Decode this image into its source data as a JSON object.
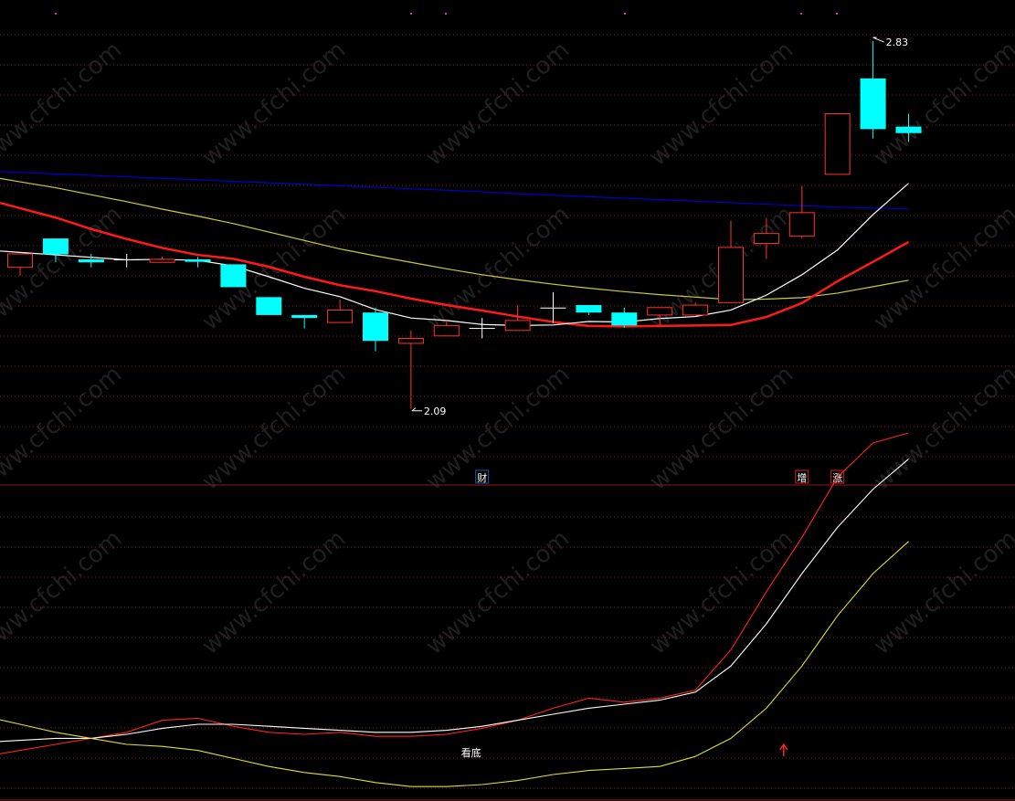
{
  "chart_data": [
    {
      "type": "candlestick",
      "title": "",
      "ylim": [
        1.972,
        2.876
      ],
      "candles": [
        {
          "open": 2.375,
          "close": 2.402,
          "high": 2.402,
          "low": 2.358
        },
        {
          "open": 2.433,
          "close": 2.401,
          "high": 2.433,
          "low": 2.385
        },
        {
          "open": 2.391,
          "close": 2.385,
          "high": 2.402,
          "low": 2.375
        },
        {
          "open": 2.391,
          "close": 2.391,
          "high": 2.402,
          "low": 2.375
        },
        {
          "open": 2.385,
          "close": 2.391,
          "high": 2.396,
          "low": 2.385
        },
        {
          "open": 2.391,
          "close": 2.386,
          "high": 2.396,
          "low": 2.375
        },
        {
          "open": 2.381,
          "close": 2.335,
          "high": 2.381,
          "low": 2.335
        },
        {
          "open": 2.315,
          "close": 2.279,
          "high": 2.315,
          "low": 2.279
        },
        {
          "open": 2.279,
          "close": 2.273,
          "high": 2.279,
          "low": 2.252
        },
        {
          "open": 2.264,
          "close": 2.289,
          "high": 2.31,
          "low": 2.264
        },
        {
          "open": 2.284,
          "close": 2.227,
          "high": 2.294,
          "low": 2.206
        },
        {
          "open": 2.222,
          "close": 2.232,
          "high": 2.248,
          "low": 2.09
        },
        {
          "open": 2.237,
          "close": 2.258,
          "high": 2.268,
          "low": 2.237
        },
        {
          "open": 2.253,
          "close": 2.253,
          "high": 2.273,
          "low": 2.232
        },
        {
          "open": 2.248,
          "close": 2.268,
          "high": 2.299,
          "low": 2.248
        },
        {
          "open": 2.294,
          "close": 2.294,
          "high": 2.325,
          "low": 2.263
        },
        {
          "open": 2.299,
          "close": 2.284,
          "high": 2.299,
          "low": 2.279
        },
        {
          "open": 2.284,
          "close": 2.258,
          "high": 2.294,
          "low": 2.253
        },
        {
          "open": 2.279,
          "close": 2.294,
          "high": 2.294,
          "low": 2.258
        },
        {
          "open": 2.279,
          "close": 2.299,
          "high": 2.304,
          "low": 2.279
        },
        {
          "open": 2.304,
          "close": 2.415,
          "high": 2.469,
          "low": 2.304
        },
        {
          "open": 2.423,
          "close": 2.443,
          "high": 2.474,
          "low": 2.392
        },
        {
          "open": 2.438,
          "close": 2.485,
          "high": 2.539,
          "low": 2.433
        },
        {
          "open": 2.562,
          "close": 2.684,
          "high": 2.684,
          "low": 2.562
        },
        {
          "open": 2.755,
          "close": 2.653,
          "high": 2.83,
          "low": 2.634
        },
        {
          "open": 2.658,
          "close": 2.645,
          "high": 2.684,
          "low": 2.627
        }
      ],
      "moving_averages": [
        {
          "color": "#0000cc",
          "values": [
            2.566,
            2.563,
            2.56,
            2.557,
            2.554,
            2.551,
            2.548,
            2.545,
            2.542,
            2.539,
            2.536,
            2.533,
            2.53,
            2.527,
            2.523,
            2.52,
            2.517,
            2.514,
            2.511,
            2.508,
            2.505,
            2.502,
            2.499,
            2.496,
            2.494,
            2.493
          ]
        },
        {
          "color": "#cccc33",
          "values": [
            2.547,
            2.535,
            2.521,
            2.507,
            2.492,
            2.478,
            2.463,
            2.446,
            2.429,
            2.412,
            2.398,
            2.385,
            2.372,
            2.36,
            2.35,
            2.341,
            2.333,
            2.326,
            2.32,
            2.315,
            2.31,
            2.311,
            2.314,
            2.323,
            2.336,
            2.349
          ]
        },
        {
          "color": "#ff1a1a",
          "values": [
            2.494,
            2.475,
            2.452,
            2.432,
            2.414,
            2.4,
            2.392,
            2.376,
            2.356,
            2.339,
            2.327,
            2.312,
            2.299,
            2.288,
            2.276,
            2.265,
            2.257,
            2.256,
            2.257,
            2.258,
            2.259,
            2.275,
            2.303,
            2.347,
            2.386,
            2.426
          ]
        },
        {
          "color": "#ffffff",
          "values": [
            2.405,
            2.4,
            2.395,
            2.39,
            2.391,
            2.389,
            2.378,
            2.356,
            2.333,
            2.316,
            2.29,
            2.273,
            2.268,
            2.26,
            2.258,
            2.259,
            2.266,
            2.265,
            2.272,
            2.276,
            2.289,
            2.319,
            2.36,
            2.41,
            2.481,
            2.544
          ]
        }
      ],
      "annotations": {
        "high": {
          "value": "2.83",
          "index": 24
        },
        "low": {
          "value": "2.09",
          "index": 11
        }
      },
      "markers": [
        {
          "text": "财",
          "index": 13,
          "color": "#ffffff",
          "border": "#2255aa"
        },
        {
          "text": "增",
          "index": 22,
          "color": "#ffffff",
          "border": "#cc2222"
        },
        {
          "text": "涨",
          "index": 23,
          "color": "#ffffff",
          "border": "#cc2222"
        }
      ]
    },
    {
      "type": "line",
      "title": "",
      "ylim": [
        0,
        100
      ],
      "series": [
        {
          "color": "#ff2222",
          "values": [
            22,
            25,
            28,
            31,
            37,
            38,
            34,
            31,
            30,
            31,
            29,
            29,
            30,
            33,
            37,
            43,
            48,
            46,
            48,
            52,
            72,
            101,
            128,
            158,
            175,
            180
          ]
        },
        {
          "color": "#ffffff",
          "values": [
            27,
            28,
            28,
            30,
            33,
            35,
            35,
            34,
            33,
            32,
            31,
            31,
            32,
            34,
            37,
            40,
            43,
            45,
            47,
            51,
            64,
            85,
            110,
            133,
            152,
            167
          ]
        },
        {
          "color": "#dddd33",
          "values": [
            35,
            31,
            28,
            25,
            24,
            22,
            18,
            14,
            11,
            9,
            6,
            4,
            4,
            5,
            7,
            10,
            12,
            13,
            14,
            19,
            28,
            43,
            64,
            89,
            110,
            126
          ]
        }
      ],
      "annotations": [
        {
          "text": "看底",
          "index": 13,
          "color": "#ffffff"
        }
      ],
      "arrows": [
        {
          "direction": "up",
          "index": 22,
          "color": "#ff2222"
        }
      ]
    }
  ],
  "watermark": "www.cfchi.com",
  "colors": {
    "up": "#ff3030",
    "down": "#00ffff",
    "doji": "#ffffff",
    "grid": "#801818",
    "divider": "#8a1a1a",
    "magenta": "#cc33cc"
  }
}
